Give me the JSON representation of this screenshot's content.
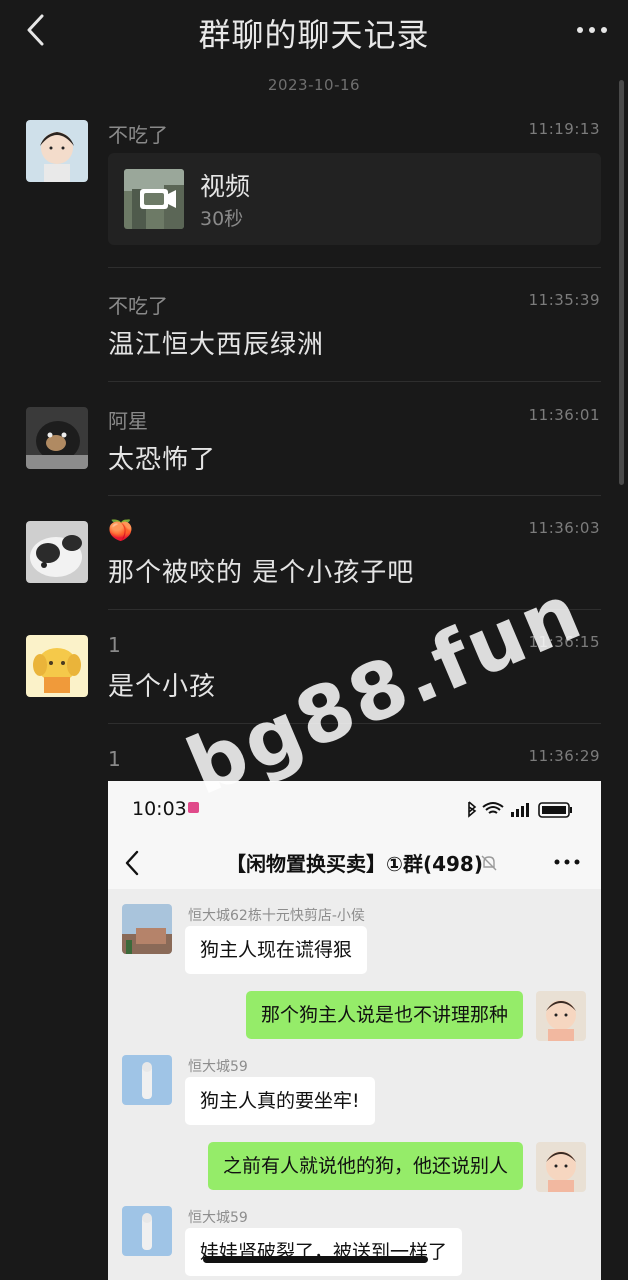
{
  "header": {
    "title": "群聊的聊天记录"
  },
  "date_separator": "2023-10-16",
  "messages": [
    {
      "sender": "不吃了",
      "time": "11:19:13",
      "video": {
        "title": "视频",
        "duration": "30秒"
      }
    },
    {
      "sender": "不吃了",
      "time": "11:35:39",
      "text": "温江恒大西辰绿洲"
    },
    {
      "sender": "阿星",
      "time": "11:36:01",
      "text": "太恐怖了"
    },
    {
      "sender": "🍑",
      "time": "11:36:03",
      "text": "那个被咬的 是个小孩子吧"
    },
    {
      "sender": "1",
      "time": "11:36:15",
      "text": "是个小孩"
    },
    {
      "sender": "1",
      "time": "11:36:29"
    }
  ],
  "screenshot": {
    "status_time": "10:03",
    "chat_title": "【闲物置换买卖】①群(498)",
    "messages": [
      {
        "side": "in",
        "sender": "恒大城62栋十元快剪店-小侯",
        "text": "狗主人现在谎得狠"
      },
      {
        "side": "out",
        "text": "那个狗主人说是也不讲理那种"
      },
      {
        "side": "in",
        "sender": "恒大城59",
        "text": "狗主人真的要坐牢!"
      },
      {
        "side": "out",
        "text": "之前有人就说他的狗，他还说别人"
      },
      {
        "side": "in",
        "sender": "恒大城59",
        "text": "娃娃肾破裂了，被送到一样了"
      }
    ]
  },
  "watermark": "bg88.fun",
  "colors": {
    "background": "#191919",
    "bubble_out": "#95ec69",
    "bubble_in": "#ffffff"
  }
}
